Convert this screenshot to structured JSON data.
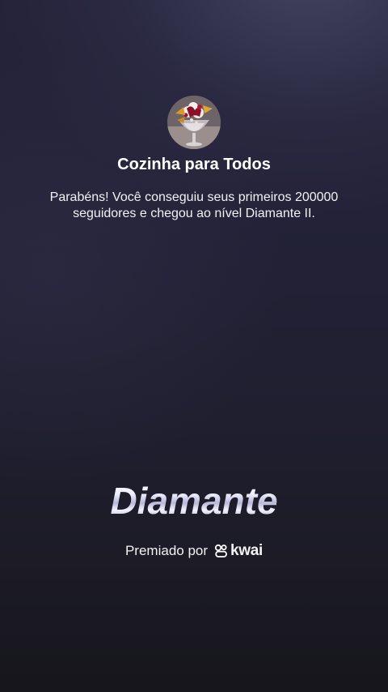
{
  "profile": {
    "name": "Cozinha para Todos"
  },
  "message": {
    "text": "Parabéns! Você conseguiu seus primeiros 200000 seguidores e chegou ao nível Diamante II."
  },
  "badge": {
    "level_name": "Diamante"
  },
  "footer": {
    "awarded_by": "Premiado por",
    "brand": "kwai",
    "brand_icon": "kwai-logo-icon"
  },
  "colors": {
    "background_top": "#24233a",
    "background_bottom": "#17161c",
    "text": "#ffffff"
  }
}
